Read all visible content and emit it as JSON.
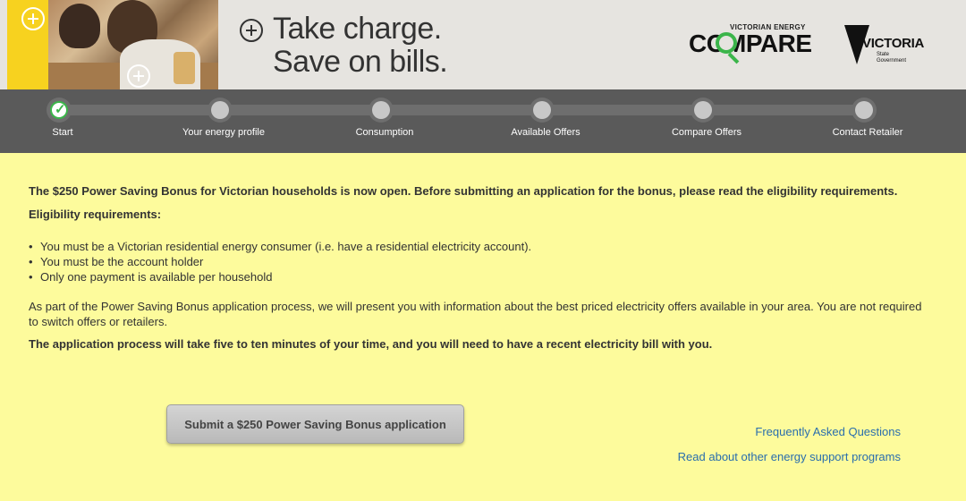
{
  "banner": {
    "tagline_line1": "Take charge.",
    "tagline_line2": "Save on bills.",
    "vec_logo": {
      "small_text": "VICTORIAN ENERGY",
      "big_text": "COMPARE"
    },
    "vic_logo": {
      "title": "VICTORIA",
      "sub_line1": "State",
      "sub_line2": "Government"
    }
  },
  "progress": {
    "steps": [
      {
        "label": "Start",
        "status": "done"
      },
      {
        "label": "Your energy profile",
        "status": "pending"
      },
      {
        "label": "Consumption",
        "status": "pending"
      },
      {
        "label": "Available Offers",
        "status": "pending"
      },
      {
        "label": "Compare Offers",
        "status": "pending"
      },
      {
        "label": "Contact Retailer",
        "status": "pending"
      }
    ]
  },
  "main": {
    "intro": "The $250 Power Saving Bonus for Victorian households is now open. Before submitting an application for the bonus, please read the eligibility requirements.",
    "eligibility_heading": "Eligibility requirements:",
    "requirements": [
      "You must be a Victorian residential energy consumer (i.e. have a residential electricity account).",
      "You must be the account holder",
      "Only one payment is available per household"
    ],
    "info": "As part of the Power Saving Bonus application process, we will present you with information about the best priced electricity offers available in your area. You are not required to switch offers or retailers.",
    "duration": "The application process will take five to ten minutes of your time, and you will need to have a recent electricity bill with you."
  },
  "actions": {
    "submit_label": "Submit a $250 Power Saving Bonus application",
    "faq_link": "Frequently Asked Questions",
    "support_link": "Read about other energy support programs"
  },
  "colors": {
    "page_background": "#fdfb9c",
    "progress_background": "#5a5a5a",
    "accent_green": "#3bb54a",
    "link_blue": "#2a6ead",
    "banner_yellow": "#f7d21f"
  }
}
